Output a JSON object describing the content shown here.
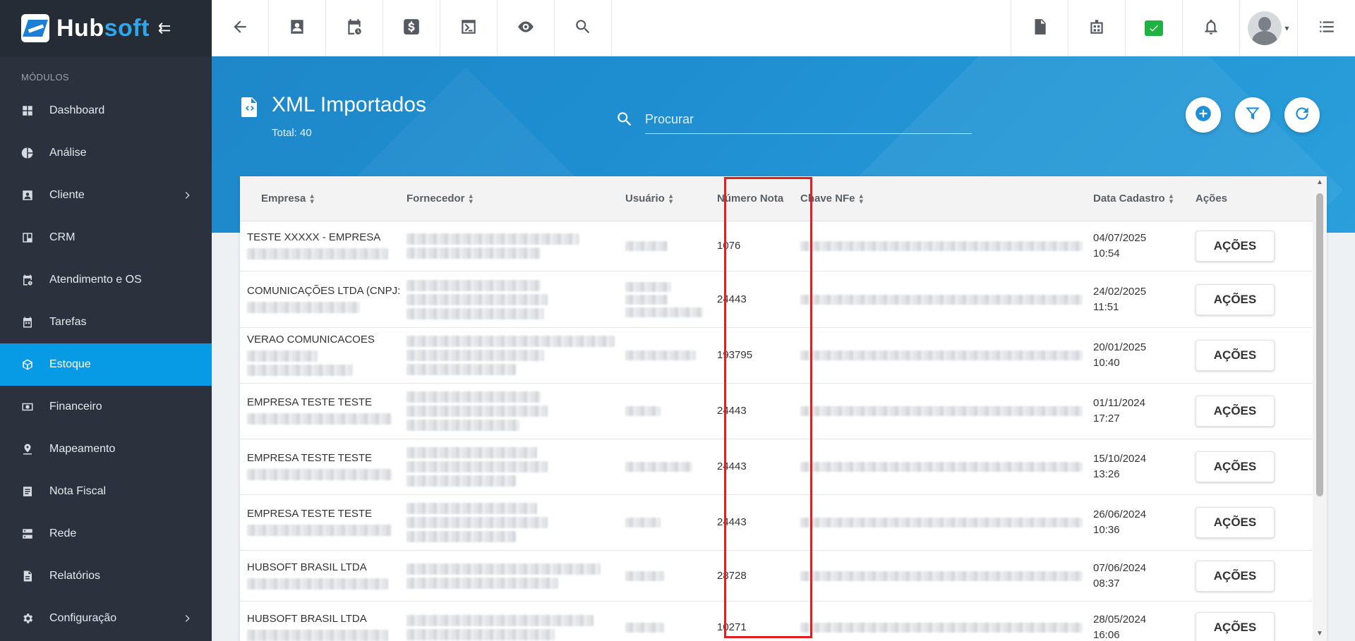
{
  "brand": {
    "hub": "Hub",
    "soft": "soft"
  },
  "sidebar": {
    "section_label": "MÓDULOS",
    "items": [
      {
        "label": "Dashboard",
        "icon": "dashboard-icon",
        "active": false,
        "has_submenu": false
      },
      {
        "label": "Análise",
        "icon": "pie-chart-icon",
        "active": false,
        "has_submenu": false
      },
      {
        "label": "Cliente",
        "icon": "contact-card-icon",
        "active": false,
        "has_submenu": true
      },
      {
        "label": "CRM",
        "icon": "kanban-icon",
        "active": false,
        "has_submenu": false
      },
      {
        "label": "Atendimento e OS",
        "icon": "calendar-clock-icon",
        "active": false,
        "has_submenu": false
      },
      {
        "label": "Tarefas",
        "icon": "tasks-calendar-icon",
        "active": false,
        "has_submenu": false
      },
      {
        "label": "Estoque",
        "icon": "box-icon",
        "active": true,
        "has_submenu": false
      },
      {
        "label": "Financeiro",
        "icon": "money-icon",
        "active": false,
        "has_submenu": false
      },
      {
        "label": "Mapeamento",
        "icon": "map-pin-icon",
        "active": false,
        "has_submenu": false
      },
      {
        "label": "Nota Fiscal",
        "icon": "document-list-icon",
        "active": false,
        "has_submenu": false
      },
      {
        "label": "Rede",
        "icon": "server-icon",
        "active": false,
        "has_submenu": false
      },
      {
        "label": "Relatórios",
        "icon": "report-icon",
        "active": false,
        "has_submenu": false
      },
      {
        "label": "Configuração",
        "icon": "gear-icon",
        "active": false,
        "has_submenu": true
      }
    ]
  },
  "topbar": {
    "left_icons": [
      "back-arrow-icon",
      "contact-icon",
      "calendar-clock-icon",
      "dollar-icon",
      "terminal-icon",
      "eye-icon",
      "search-icon"
    ],
    "right_icons": [
      "pdf-icon",
      "building-icon",
      "chat-check-icon",
      "bell-icon",
      "avatar",
      "menu-list-icon"
    ],
    "chat_color": "#1fb141"
  },
  "page": {
    "title": "XML Importados",
    "subtitle": "Total: 40",
    "search_placeholder": "Procurar",
    "hero_color": "#1f8fd1"
  },
  "table": {
    "columns": [
      "Empresa",
      "Fornecedor",
      "Usuário",
      "Número Nota",
      "Chave NFe",
      "Data Cadastro",
      "Ações"
    ],
    "rows": [
      {
        "empresa": "TESTE XXXXX - EMPRESA",
        "numero": "1076",
        "data": "04/07/2025",
        "hora": "10:54",
        "acao": "AÇÕES"
      },
      {
        "empresa": "COMUNICAÇÕES LTDA (CNPJ:",
        "numero": "24443",
        "data": "24/02/2025",
        "hora": "11:51",
        "acao": "AÇÕES"
      },
      {
        "empresa": "VERAO COMUNICACOES",
        "numero": "193795",
        "data": "20/01/2025",
        "hora": "10:40",
        "acao": "AÇÕES"
      },
      {
        "empresa": "EMPRESA TESTE TESTE",
        "numero": "24443",
        "data": "01/11/2024",
        "hora": "17:27",
        "acao": "AÇÕES"
      },
      {
        "empresa": "EMPRESA TESTE TESTE",
        "numero": "24443",
        "data": "15/10/2024",
        "hora": "13:26",
        "acao": "AÇÕES"
      },
      {
        "empresa": "EMPRESA TESTE TESTE",
        "numero": "24443",
        "data": "26/06/2024",
        "hora": "10:36",
        "acao": "AÇÕES"
      },
      {
        "empresa": "HUBSOFT BRASIL LTDA",
        "numero": "28728",
        "data": "07/06/2024",
        "hora": "08:37",
        "acao": "AÇÕES"
      },
      {
        "empresa": "HUBSOFT BRASIL LTDA",
        "numero": "10271",
        "data": "28/05/2024",
        "hora": "16:06",
        "acao": "AÇÕES"
      }
    ],
    "highlight_color": "#e02020"
  }
}
